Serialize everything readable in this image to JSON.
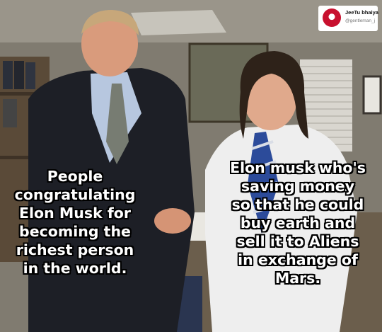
{
  "watermark": {
    "name": "JeeTu bhaiya",
    "handle": "@gentleman_j",
    "accent_color": "#c8102e"
  },
  "left_caption": {
    "lines": [
      "People",
      "congratulating",
      "Elon Musk for",
      "becoming the",
      "richest person",
      "in the world."
    ]
  },
  "right_caption": {
    "lines": [
      "Elon musk who's",
      "saving money",
      "so that he could",
      "buy earth and",
      "sell it to Aliens",
      "in exchange of",
      "Mars."
    ]
  }
}
